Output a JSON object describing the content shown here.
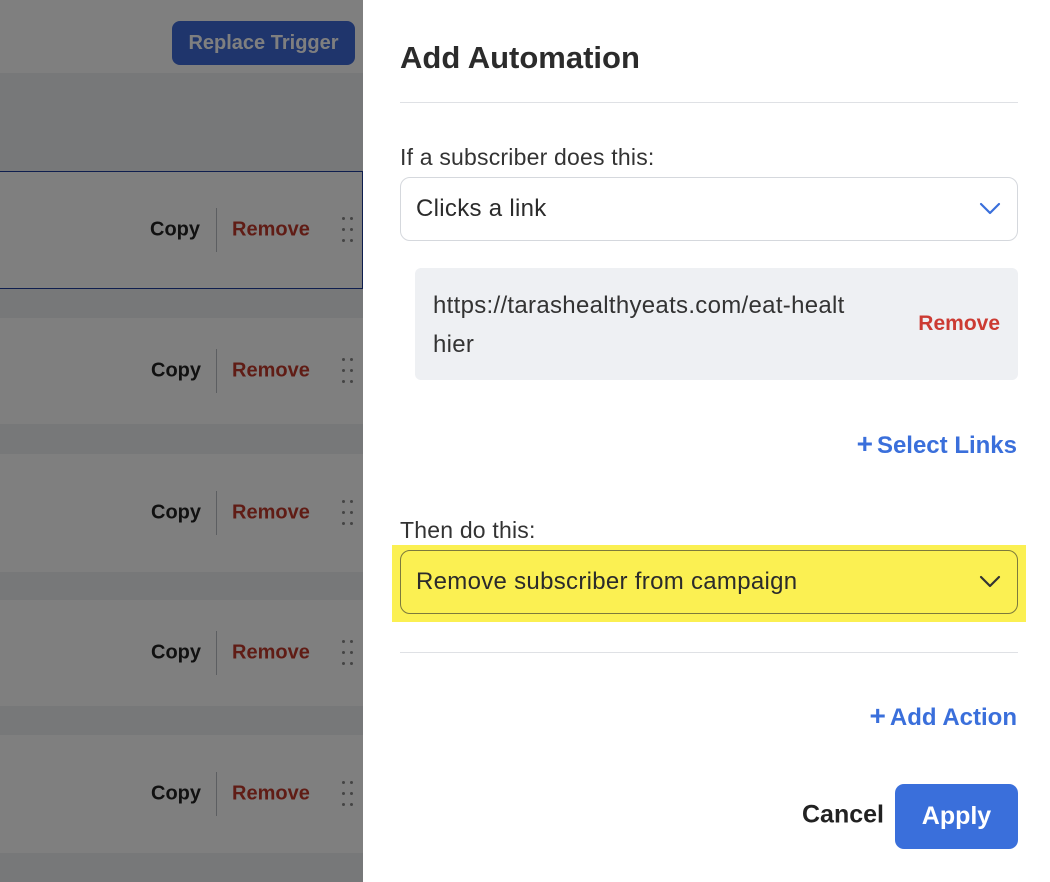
{
  "background": {
    "replace_trigger_label": "Replace Trigger",
    "rows": [
      {
        "copy_label": "Copy",
        "remove_label": "Remove"
      },
      {
        "copy_label": "Copy",
        "remove_label": "Remove"
      },
      {
        "copy_label": "Copy",
        "remove_label": "Remove"
      },
      {
        "copy_label": "Copy",
        "remove_label": "Remove"
      },
      {
        "copy_label": "Copy",
        "remove_label": "Remove"
      }
    ]
  },
  "panel": {
    "title": "Add Automation",
    "trigger_label": "If a subscriber does this:",
    "trigger_value": "Clicks a link",
    "link_url": "https://tarashealthyeats.com/eat-healthier",
    "link_remove_label": "Remove",
    "select_links_label": "Select Links",
    "action_label": "Then do this:",
    "action_value": "Remove subscriber from campaign",
    "add_action_label": "Add Action",
    "cancel_label": "Cancel",
    "apply_label": "Apply"
  },
  "colors": {
    "primary": "#3a6fdb",
    "danger": "#cc3b33",
    "highlight": "#fbf052"
  }
}
